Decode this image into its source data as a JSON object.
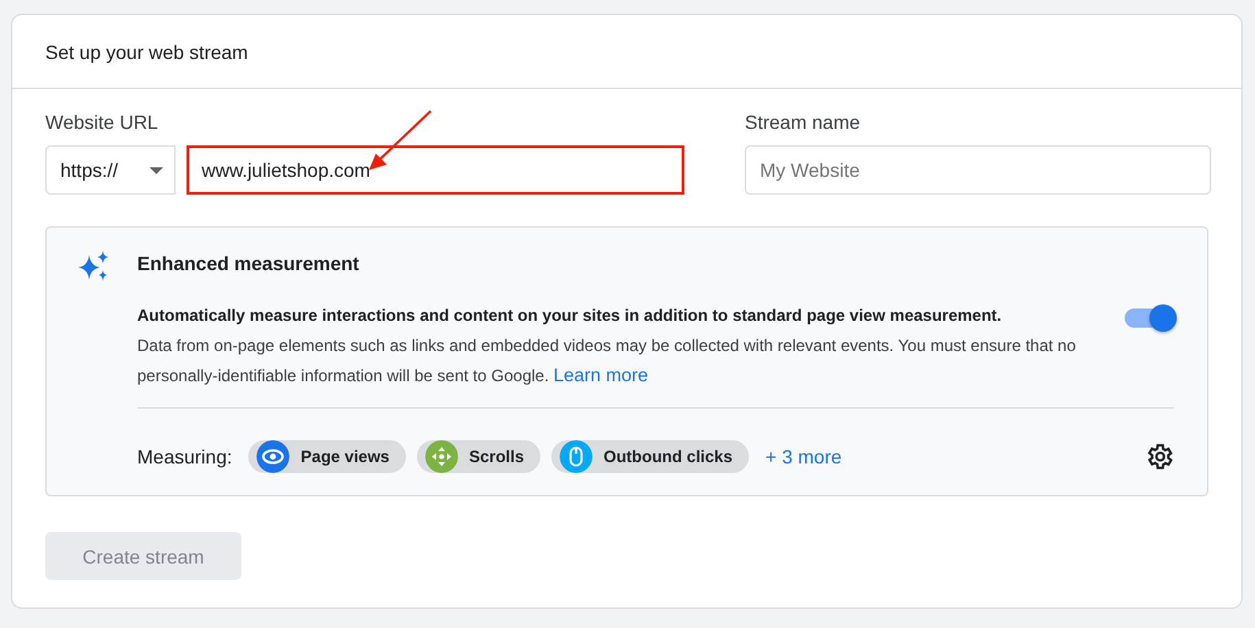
{
  "card": {
    "title": "Set up your web stream"
  },
  "website_url": {
    "label": "Website URL",
    "protocol": "https://",
    "value": "www.julietshop.com",
    "highlighted": true
  },
  "stream_name": {
    "label": "Stream name",
    "placeholder": "My Website"
  },
  "enhanced_measurement": {
    "title": "Enhanced measurement",
    "summary": "Automatically measure interactions and content on your sites in addition to standard page view measurement.",
    "description": "Data from on-page elements such as links and embedded videos may be collected with relevant events. You must ensure that no personally-identifiable information will be sent to Google.",
    "link": "Learn more",
    "on": true,
    "measuring_label": "Measuring:",
    "chips": [
      {
        "kind": "eye",
        "label": "Page views",
        "color": "#1a73e8"
      },
      {
        "kind": "scroll",
        "label": "Scrolls",
        "color": "#7cb342"
      },
      {
        "kind": "mouse",
        "label": "Outbound clicks",
        "color": "#03a9f4"
      }
    ],
    "more": "+ 3 more"
  },
  "create_button": {
    "label": "Create stream",
    "disabled": true
  }
}
